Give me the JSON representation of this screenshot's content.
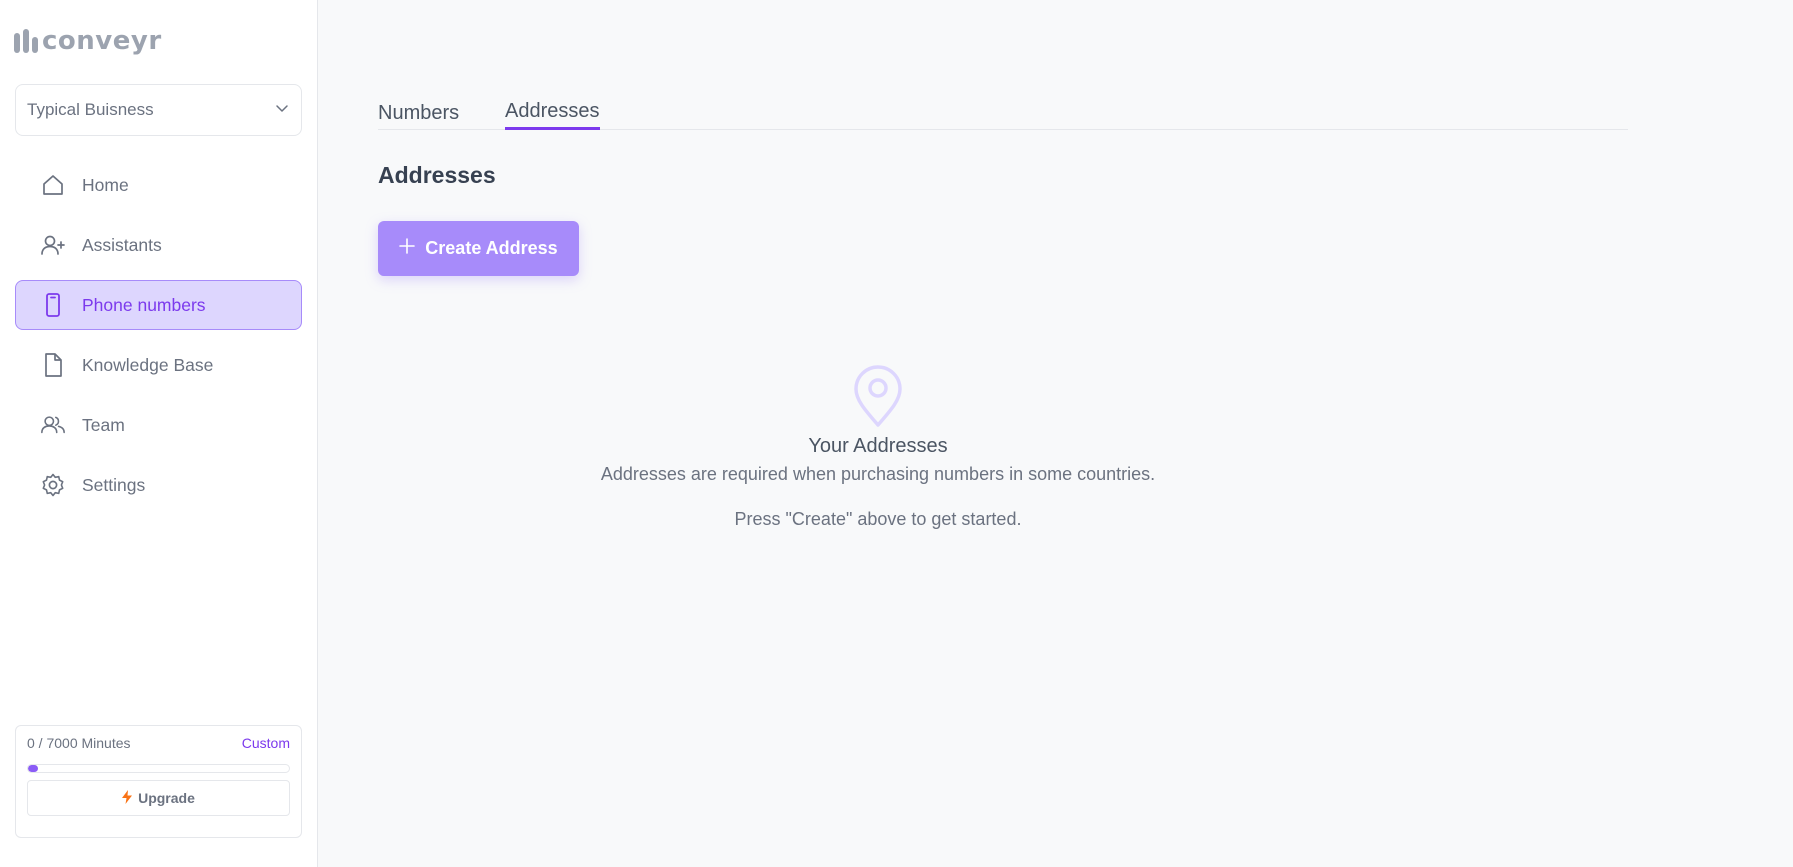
{
  "brand": {
    "name": "conveyr"
  },
  "org_selector": {
    "value": "Typical Buisness"
  },
  "sidebar": {
    "items": [
      {
        "label": "Home",
        "icon": "home-icon",
        "active": false
      },
      {
        "label": "Assistants",
        "icon": "user-plus-icon",
        "active": false
      },
      {
        "label": "Phone numbers",
        "icon": "phone-icon",
        "active": true
      },
      {
        "label": "Knowledge Base",
        "icon": "document-icon",
        "active": false
      },
      {
        "label": "Team",
        "icon": "users-icon",
        "active": false
      },
      {
        "label": "Settings",
        "icon": "gear-icon",
        "active": false
      }
    ]
  },
  "usage": {
    "minutes_text": "0 / 7000 Minutes",
    "plan": "Custom",
    "progress_fraction": 0.0,
    "upgrade_label": "Upgrade"
  },
  "tabs": [
    {
      "label": "Numbers",
      "active": false
    },
    {
      "label": "Addresses",
      "active": true
    }
  ],
  "main": {
    "title": "Addresses",
    "create_button": "Create Address"
  },
  "empty_state": {
    "icon": "map-pin-icon",
    "title": "Your Addresses",
    "description": "Addresses are required when purchasing numbers in some countries.",
    "hint": "Press \"Create\" above to get started."
  },
  "colors": {
    "accent": "#7c3aed",
    "accent_light": "#ddd6fe",
    "button": "#a78bfa"
  }
}
